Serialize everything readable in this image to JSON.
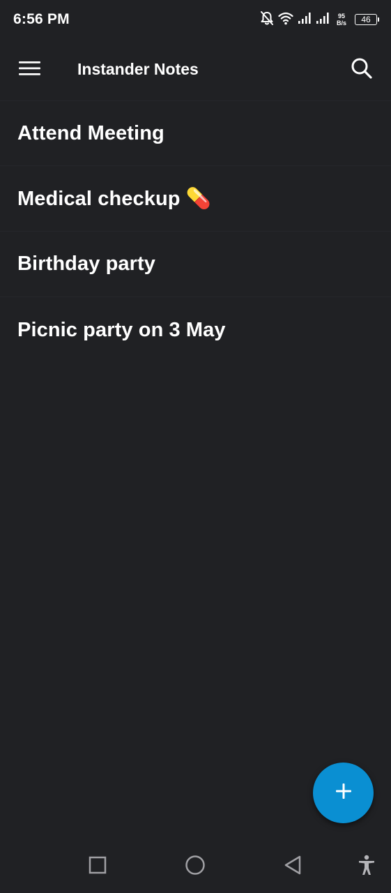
{
  "status_bar": {
    "time": "6:56 PM",
    "net_speed_value": "95",
    "net_speed_unit": "B/s",
    "battery_level": "46",
    "icons": [
      "bell-off-icon",
      "wifi-icon",
      "signal-icon",
      "signal-icon"
    ]
  },
  "app_bar": {
    "title": "Instander Notes",
    "menu_icon": "hamburger-menu-icon",
    "search_icon": "search-icon"
  },
  "notes": [
    {
      "title": "Attend Meeting"
    },
    {
      "title": "Medical checkup 💊"
    },
    {
      "title": "Birthday party"
    },
    {
      "title": "Picnic party on 3 May"
    }
  ],
  "fab": {
    "icon": "plus-icon",
    "color": "#0a8fd2"
  },
  "nav_bar": {
    "icons": [
      "recents-square-icon",
      "home-circle-icon",
      "back-triangle-icon",
      "accessibility-icon"
    ]
  },
  "colors": {
    "background": "#202124",
    "text": "#ffffff",
    "accent": "#0a8fd2"
  }
}
